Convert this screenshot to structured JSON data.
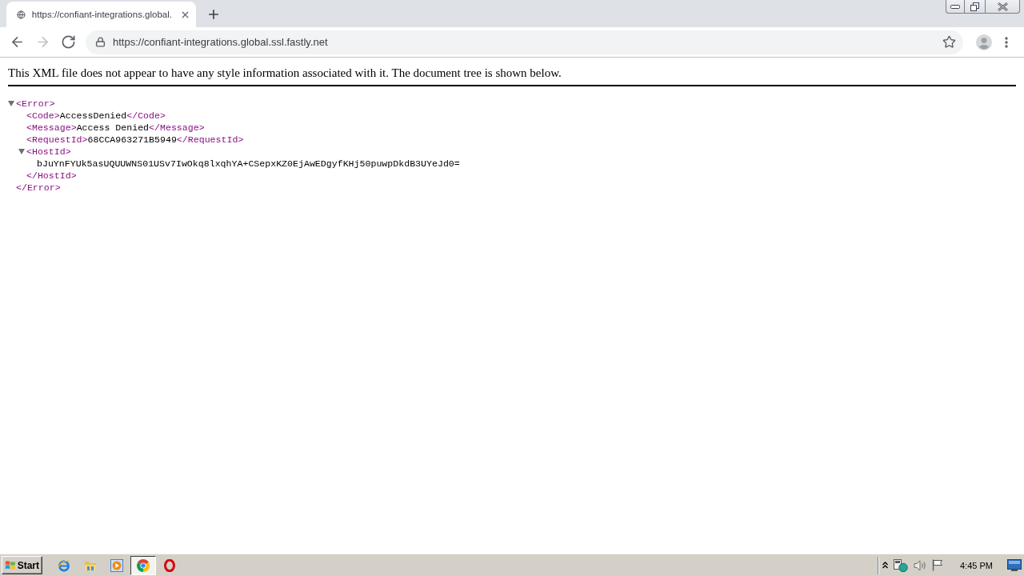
{
  "window": {
    "tabs": [
      {
        "title": "https://confiant-integrations.global.",
        "selected": true
      }
    ]
  },
  "toolbar": {
    "nav_buttons": [
      {
        "kind": "back",
        "disabled": false
      },
      {
        "kind": "forward",
        "disabled": true
      },
      {
        "kind": "reload",
        "disabled": false
      }
    ],
    "address": "https://confiant-integrations.global.ssl.fastly.net"
  },
  "page": {
    "notice": "This XML file does not appear to have any style information associated with it. The document tree is shown below.",
    "xml_tree": {
      "open_tag": "<Error>",
      "close_tag": "</Error>",
      "expanded": true,
      "children": [
        {
          "open_tag": "<Code>",
          "text": "AccessDenied",
          "close_tag": "</Code>"
        },
        {
          "open_tag": "<Message>",
          "text": "Access Denied",
          "close_tag": "</Message>"
        },
        {
          "open_tag": "<RequestId>",
          "text": "68CCA963271B5949",
          "close_tag": "</RequestId>"
        },
        {
          "open_tag": "<HostId>",
          "close_tag": "</HostId>",
          "expanded": true,
          "children": [
            {
              "text": "bJuYnFYUk5asUQUUWNS01USv7IwOkq8lxqhYA+CSepxKZ0EjAwEDgyfKHj50puwpDkdB3UYeJd0="
            }
          ]
        }
      ]
    }
  },
  "taskbar": {
    "start_label": "Start",
    "apps": [
      {
        "kind": "ie",
        "selected": false
      },
      {
        "kind": "folder",
        "selected": false
      },
      {
        "kind": "media",
        "selected": false
      },
      {
        "kind": "chrome",
        "selected": true
      },
      {
        "kind": "opera",
        "selected": false
      }
    ],
    "clock": "4:45 PM"
  }
}
